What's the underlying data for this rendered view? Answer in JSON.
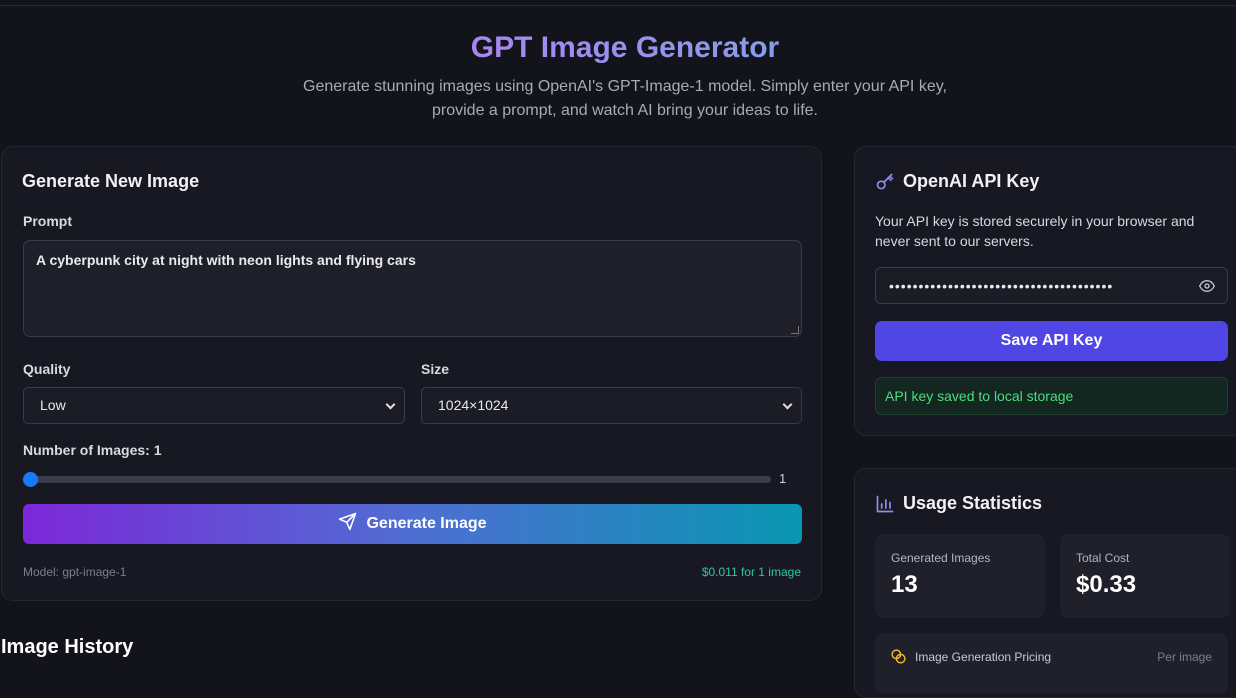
{
  "header": {
    "title": "GPT Image Generator",
    "subtitle": "Generate stunning images using OpenAI's GPT-Image-1 model. Simply enter your API key, provide a prompt, and watch AI bring your ideas to life."
  },
  "generator": {
    "heading": "Generate New Image",
    "prompt_label": "Prompt",
    "prompt_value": "A cyberpunk city at night with neon lights and flying cars",
    "quality_label": "Quality",
    "quality_value": "Low",
    "size_label": "Size",
    "size_value": "1024×1024",
    "count_label": "Number of Images: 1",
    "count_value": "1",
    "count_slider": {
      "value": 1,
      "min": 1
    },
    "generate_label": "Generate Image",
    "model_text": "Model: gpt-image-1",
    "cost_text": "$0.011 for 1 image"
  },
  "api_key": {
    "heading": "OpenAI API Key",
    "description": "Your API key is stored securely in your browser and never sent to our servers.",
    "masked_value": "••••••••••••••••••••••••••••••••••••••",
    "save_label": "Save API Key",
    "status_message": "API key saved to local storage"
  },
  "stats": {
    "heading": "Usage Statistics",
    "generated_label": "Generated Images",
    "generated_value": "13",
    "cost_label": "Total Cost",
    "cost_value": "$0.33",
    "pricing_label": "Image Generation Pricing",
    "pricing_unit": "Per image"
  },
  "history": {
    "heading": "Image History"
  },
  "icons": {
    "key": "key-icon",
    "send": "send-icon",
    "eye": "eye-icon",
    "chart": "bar-chart-icon",
    "coins": "coins-icon"
  },
  "colors": {
    "accent": "#4f46e5",
    "success": "#4ade80",
    "cost": "#2cc7a8",
    "slider": "#1779ff"
  }
}
